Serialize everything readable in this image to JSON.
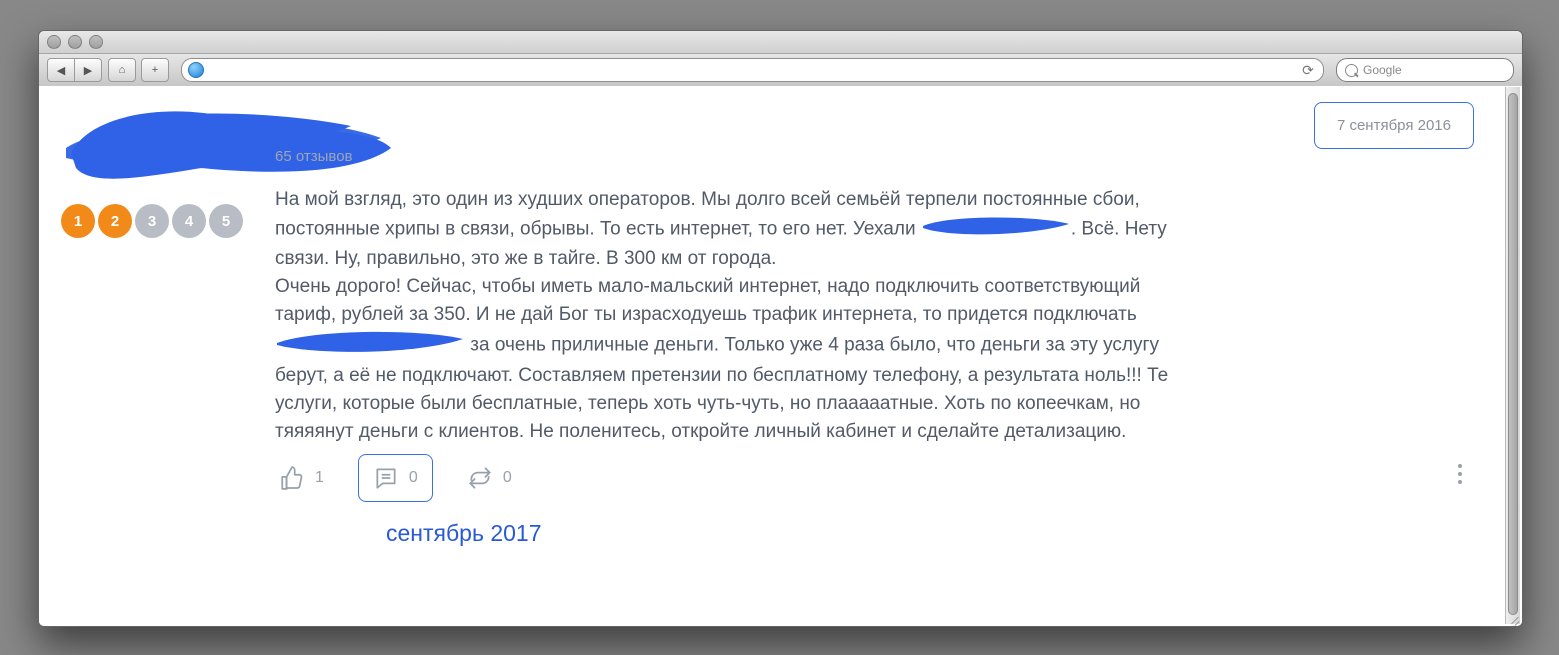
{
  "browser": {
    "search_placeholder": "Google"
  },
  "review": {
    "stats_line": "65 отзывов",
    "date": "7 сентября 2016",
    "rating": {
      "score": 2,
      "max": 5,
      "labels": [
        "1",
        "2",
        "3",
        "4",
        "5"
      ]
    },
    "body": {
      "p1_a": "На мой взгляд, это один из худших операторов. Мы долго всей семьёй терпели постоянные сбои, постоянные хрипы в связи, обрывы. То есть интернет, то его нет. Уехали ",
      "p1_b": ". Всё. Нету связи. Ну, правильно, это же в тайге. В 300 км от города.",
      "p2_a": "Очень дорого! Сейчас, чтобы иметь мало-мальский интернет, надо подключить соответствующий тариф, рублей за 350. И не дай Бог ты израсходуешь трафик интернета, то придется подключать ",
      "p2_b": " за очень приличные деньги. Только уже 4 раза было, что деньги за эту услугу берут, а её не подключают. Составляем претензии по бесплатному телефону, а результата ноль!!! Те услуги, которые были бесплатные, теперь хоть чуть-чуть, но плааааатные. Хоть по копеечкам, но тяяяянут деньги с клиентов. Не поленитесь, откройте личный кабинет и сделайте детализацию."
    },
    "likes": "1",
    "comments": "0",
    "shares": "0"
  },
  "month_label": "сентябрь 2017"
}
